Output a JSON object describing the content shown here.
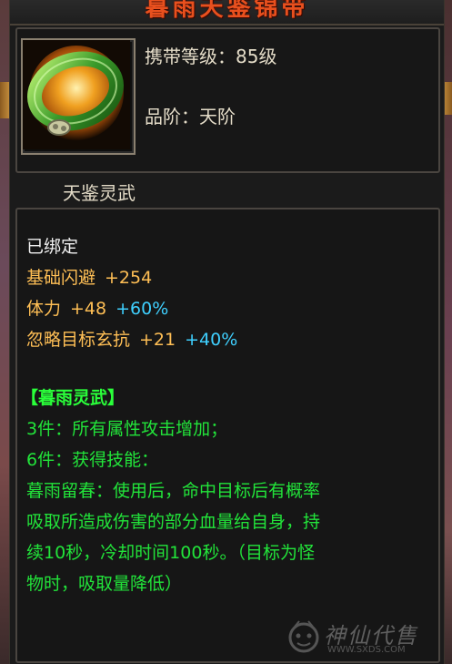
{
  "item": {
    "name": "暮雨天鉴锦带",
    "level_label": "携带等级：85级",
    "grade_label": "品阶：天阶",
    "subtitle": "天鉴灵武"
  },
  "stats": {
    "bind_status": "已绑定",
    "dodge": {
      "label": "基础闪避",
      "value": "+254"
    },
    "stamina": {
      "label": "体力",
      "value": "+48",
      "percent": "+60%"
    },
    "ignore_resist": {
      "label": "忽略目标玄抗",
      "value": "+21",
      "percent": "+40%"
    }
  },
  "set": {
    "title": "【暮雨灵武】",
    "piece3": "3件：所有属性攻击增加；",
    "piece6": "6件：获得技能：",
    "skill_lines": [
      "暮雨留春：使用后，命中目标后有概率",
      "吸取所造成伤害的部分血量给自身，持",
      "续10秒，冷却时间100秒。（目标为怪",
      "物时，吸取量降低）"
    ]
  },
  "watermark": {
    "text": "神仙代售",
    "url": "WWW.SXDS.COM"
  },
  "colors": {
    "title": "#e8501e",
    "orange": "#ffbf55",
    "cyan": "#3fd0ff",
    "green": "#22e43a"
  },
  "icons": {
    "item_icon": "jade-bracelet-icon"
  }
}
